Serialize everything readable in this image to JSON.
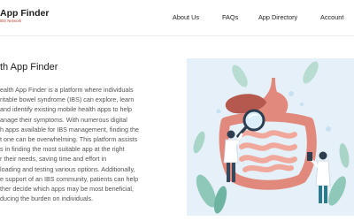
{
  "header": {
    "brand_title": "App Finder",
    "brand_subtitle": "IBS Network",
    "nav": {
      "about": "About Us",
      "faqs": "FAQs",
      "directory": "App Directory",
      "account": "Account"
    }
  },
  "hero": {
    "title": "th App Finder",
    "lines": [
      "ealth App Finder is a platform where individuals",
      "ritable bowel syndrome (IBS) can explore, learn",
      "and identify existing mobile health apps to help",
      "anage their symptoms. With numerous digital",
      "h apps available for IBS management, finding the",
      "t one can be overwhelming. This platform assists",
      "s in finding the most suitable app at the right",
      "r their needs, saving time and effort in",
      "loading and testing various options. Additionally,",
      "e support of an IBS community, patients can help",
      "ther decide which apps may be most beneficial,",
      "ducing the burden on individuals."
    ]
  },
  "colors": {
    "brand_accent": "#c0392b",
    "illustration_bg": "#e6f0f8",
    "intestine": "#e2897e",
    "body_text": "#555555"
  },
  "icons": {
    "illustration": "digestive-system-illustration",
    "magnifier": "magnifying-glass-icon"
  }
}
